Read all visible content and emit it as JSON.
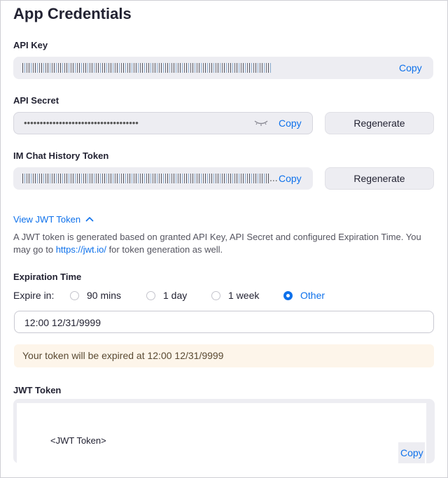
{
  "page": {
    "title": "App Credentials"
  },
  "api_key": {
    "label": "API Key",
    "value_masked": "9Z39OC1DOOD34I9Z39OC1DOOD34I9Z39OC1DOOD1",
    "copy_label": "Copy"
  },
  "api_secret": {
    "label": "API Secret",
    "value_masked": "••••••••••••••••••••••••••••••••••••",
    "copy_label": "Copy",
    "regenerate_label": "Regenerate",
    "visibility_icon": "eye-closed-icon"
  },
  "im_token": {
    "label": "IM Chat History Token",
    "value_masked": "9Z39OC1DOOD34I9Z39OC1DOOD34I9Z39OC1DOOD1...",
    "copy_label": "Copy",
    "regenerate_label": "Regenerate"
  },
  "jwt_toggle": {
    "label": "View JWT Token",
    "icon": "chevron-up-icon"
  },
  "description": {
    "before": "A JWT token is generated based on granted API Key, API Secret and configured Expiration Time. You may go to ",
    "link": "https://jwt.io/",
    "after": " for token generation as well."
  },
  "expiration": {
    "label": "Expiration Time",
    "expire_in_label": "Expire in:",
    "options": [
      "90 mins",
      "1 day",
      "1 week",
      "Other"
    ],
    "selected": "Other",
    "custom_value": "12:00 12/31/9999",
    "notice": "Your token will be expired at 12:00 12/31/9999"
  },
  "jwt_token": {
    "label": "JWT Token",
    "value": "<JWT Token>",
    "copy_label": "Copy"
  },
  "colors": {
    "accent": "#0e71eb",
    "field_bg": "#ededf2",
    "notice_bg": "#fdf5ea"
  }
}
